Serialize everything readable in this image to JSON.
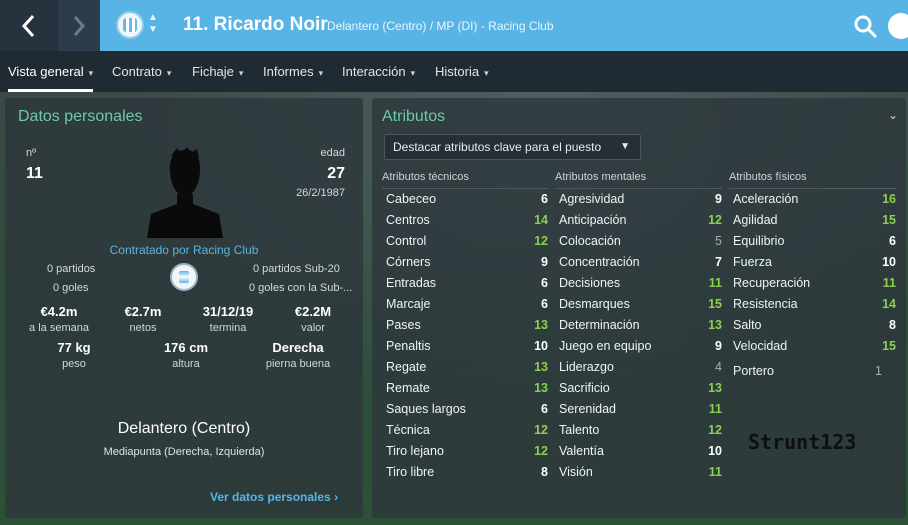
{
  "header": {
    "player_name": "11. Ricardo Noir",
    "player_sub": "Delantero (Centro) / MP (DI) - Racing Club"
  },
  "menu": {
    "items": [
      {
        "label": "Vista general"
      },
      {
        "label": "Contrato"
      },
      {
        "label": "Fichaje"
      },
      {
        "label": "Informes"
      },
      {
        "label": "Interacción"
      },
      {
        "label": "Historia"
      }
    ]
  },
  "personal": {
    "title": "Datos personales",
    "number_label": "nº",
    "number": "11",
    "age_label": "edad",
    "age": "27",
    "dob": "26/2/1987",
    "contract_text": "Contratado por Racing Club",
    "matches_left": "0 partidos",
    "goals_left": "0 goles",
    "matches_right": "0 partidos Sub-20",
    "goals_right": "0 goles con la Sub-...",
    "wage": "€4.2m",
    "wage_label": "a la semana",
    "net": "€2.7m",
    "net_label": "netos",
    "expiry": "31/12/19",
    "expiry_label": "termina",
    "value": "€2.2M",
    "value_label": "valor",
    "weight": "77 kg",
    "weight_label": "peso",
    "height": "176 cm",
    "height_label": "altura",
    "foot": "Derecha",
    "foot_label": "pierna buena",
    "position": "Delantero (Centro)",
    "position_sub": "Mediapunta (Derecha, Izquierda)",
    "more_link": "Ver datos personales"
  },
  "attributes": {
    "title": "Atributos",
    "dropdown": "Destacar atributos clave para el puesto",
    "technical": {
      "header": "Atributos técnicos",
      "items": [
        {
          "name": "Cabeceo",
          "value": "6",
          "tone": "white"
        },
        {
          "name": "Centros",
          "value": "14",
          "tone": "green"
        },
        {
          "name": "Control",
          "value": "12",
          "tone": "green"
        },
        {
          "name": "Córners",
          "value": "9",
          "tone": "white"
        },
        {
          "name": "Entradas",
          "value": "6",
          "tone": "white"
        },
        {
          "name": "Marcaje",
          "value": "6",
          "tone": "white"
        },
        {
          "name": "Pases",
          "value": "13",
          "tone": "green"
        },
        {
          "name": "Penaltis",
          "value": "10",
          "tone": "white"
        },
        {
          "name": "Regate",
          "value": "13",
          "tone": "green"
        },
        {
          "name": "Remate",
          "value": "13",
          "tone": "green"
        },
        {
          "name": "Saques largos",
          "value": "6",
          "tone": "white"
        },
        {
          "name": "Técnica",
          "value": "12",
          "tone": "green"
        },
        {
          "name": "Tiro lejano",
          "value": "12",
          "tone": "green"
        },
        {
          "name": "Tiro libre",
          "value": "8",
          "tone": "white"
        }
      ]
    },
    "mental": {
      "header": "Atributos mentales",
      "items": [
        {
          "name": "Agresividad",
          "value": "9",
          "tone": "white"
        },
        {
          "name": "Anticipación",
          "value": "12",
          "tone": "green"
        },
        {
          "name": "Colocación",
          "value": "5",
          "tone": "grey"
        },
        {
          "name": "Concentración",
          "value": "7",
          "tone": "white"
        },
        {
          "name": "Decisiones",
          "value": "11",
          "tone": "green"
        },
        {
          "name": "Desmarques",
          "value": "15",
          "tone": "green"
        },
        {
          "name": "Determinación",
          "value": "13",
          "tone": "green"
        },
        {
          "name": "Juego en equipo",
          "value": "9",
          "tone": "white"
        },
        {
          "name": "Liderazgo",
          "value": "4",
          "tone": "grey"
        },
        {
          "name": "Sacrificio",
          "value": "13",
          "tone": "green"
        },
        {
          "name": "Serenidad",
          "value": "11",
          "tone": "green"
        },
        {
          "name": "Talento",
          "value": "12",
          "tone": "green"
        },
        {
          "name": "Valentía",
          "value": "10",
          "tone": "white"
        },
        {
          "name": "Visión",
          "value": "11",
          "tone": "green"
        }
      ]
    },
    "physical": {
      "header": "Atributos físicos",
      "items": [
        {
          "name": "Aceleración",
          "value": "16",
          "tone": "green"
        },
        {
          "name": "Agilidad",
          "value": "15",
          "tone": "green"
        },
        {
          "name": "Equilibrio",
          "value": "6",
          "tone": "white"
        },
        {
          "name": "Fuerza",
          "value": "10",
          "tone": "white"
        },
        {
          "name": "Recuperación",
          "value": "11",
          "tone": "green"
        },
        {
          "name": "Resistencia",
          "value": "14",
          "tone": "green"
        },
        {
          "name": "Salto",
          "value": "8",
          "tone": "white"
        },
        {
          "name": "Velocidad",
          "value": "15",
          "tone": "green"
        }
      ],
      "goalkeeper": {
        "name": "Portero",
        "value": "1",
        "tone": "grey"
      }
    }
  },
  "watermark": "Strunt123",
  "colors": {
    "accent_blue": "#59b4e6",
    "title_green": "#6cc9a9",
    "value_green": "#8bd04f"
  }
}
